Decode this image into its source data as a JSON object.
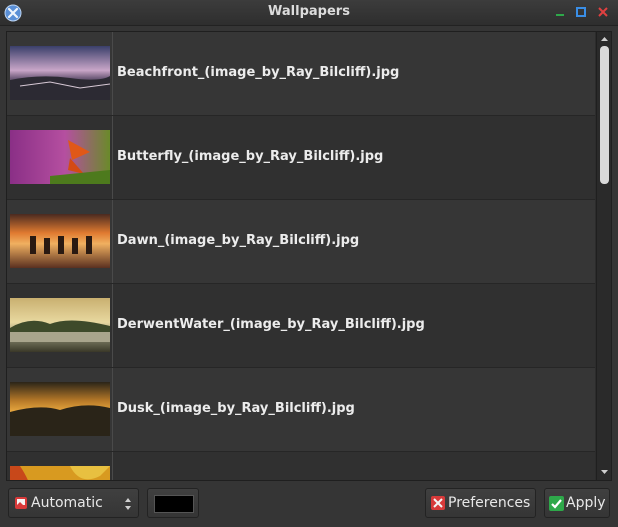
{
  "window": {
    "title": "Wallpapers"
  },
  "titlebar_icons": {
    "app": "x-logo-icon",
    "minimize": "minimize-icon",
    "maximize": "maximize-icon",
    "close": "close-icon"
  },
  "wallpapers": [
    {
      "name": "Beachfront_(image_by_Ray_Bilcliff).jpg"
    },
    {
      "name": "Butterfly_(image_by_Ray_Bilcliff).jpg"
    },
    {
      "name": "Dawn_(image_by_Ray_Bilcliff).jpg"
    },
    {
      "name": "DerwentWater_(image_by_Ray_Bilcliff).jpg"
    },
    {
      "name": "Dusk_(image_by_Ray_Bilcliff).jpg"
    },
    {
      "name": ""
    }
  ],
  "toolbar": {
    "mode_label": "Automatic",
    "color_value": "#000000",
    "preferences_label": "Preferences",
    "apply_label": "Apply"
  },
  "colors": {
    "accent_green": "#2ea84a",
    "accent_blue": "#3a8ee6",
    "accent_red": "#e04040"
  }
}
